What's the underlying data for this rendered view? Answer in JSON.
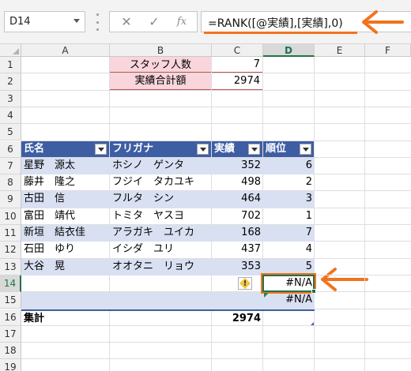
{
  "name_box": "D14",
  "formula_buttons": {
    "cancel": "✕",
    "enter": "✓",
    "function": "fx"
  },
  "formula": "=RANK([@実績],[実績],0)",
  "columns": [
    "A",
    "B",
    "C",
    "D",
    "E",
    "F"
  ],
  "selected_column": "D",
  "rows": [
    "1",
    "2",
    "3",
    "4",
    "5",
    "6",
    "7",
    "8",
    "9",
    "10",
    "11",
    "12",
    "13",
    "14",
    "15",
    "16",
    "17",
    "18",
    "19"
  ],
  "selected_row": "14",
  "summary": [
    {
      "label": "スタッフ人数",
      "value": "7"
    },
    {
      "label": "実績合計額",
      "value": "2974"
    }
  ],
  "table": {
    "headers": [
      "氏名",
      "フリガナ",
      "実績",
      "順位"
    ],
    "rows": [
      [
        "星野　源太",
        "ホシノ　ゲンタ",
        "352",
        "6"
      ],
      [
        "藤井　隆之",
        "フジイ　タカユキ",
        "498",
        "2"
      ],
      [
        "古田　信",
        "フルタ　シン",
        "464",
        "3"
      ],
      [
        "富田　靖代",
        "トミタ　ヤスヨ",
        "702",
        "1"
      ],
      [
        "新垣　結衣佳",
        "アラガキ　ユイカ",
        "168",
        "7"
      ],
      [
        "石田　ゆり",
        "イシダ　ユリ",
        "437",
        "4"
      ],
      [
        "大谷　晃",
        "オオタニ　リョウ",
        "353",
        "5"
      ],
      [
        "",
        "",
        "",
        "#N/A"
      ],
      [
        "",
        "",
        "",
        "#N/A"
      ]
    ],
    "total_label": "集計",
    "total_value": "2974"
  },
  "error_icon": "warning-diamond-icon",
  "colors": {
    "header": "#3e5ea4",
    "band": "#d9e0f2",
    "summary": "#f9d5dc",
    "accent": "#f2731e",
    "excel_green": "#217346"
  }
}
